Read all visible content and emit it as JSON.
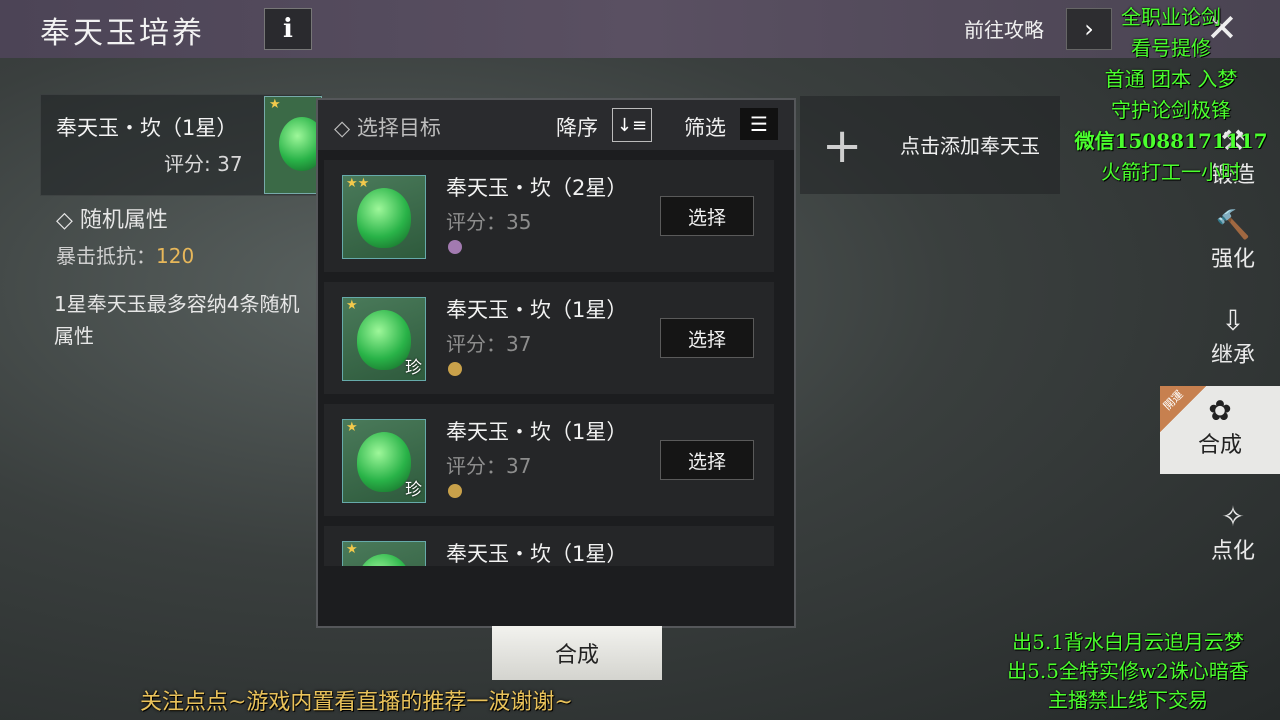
{
  "header": {
    "title": "奉天玉培养",
    "info_icon": "i",
    "guide_label": "前往攻略",
    "guide_arrow": "›",
    "close_icon": "✕"
  },
  "current_gem": {
    "name": "奉天玉・坎（1星）",
    "score": "评分: 37",
    "attr_title": "◇ 随机属性",
    "attr_name": "暴击抵抗：",
    "attr_value": "120",
    "note": "1星奉天玉最多容纳4条随机属性"
  },
  "add_slot": {
    "plus": "+",
    "text": "点击添加奉天玉"
  },
  "side_menu": [
    {
      "label": "锻造",
      "icon": "⚒"
    },
    {
      "label": "强化",
      "icon": "🔨"
    },
    {
      "label": "继承",
      "icon": "⇩"
    },
    {
      "label": "合成",
      "icon": "✿",
      "badge": "開運"
    },
    {
      "label": "点化",
      "icon": "✧"
    }
  ],
  "popup": {
    "title": "◇ 选择目标",
    "sort_label": "降序",
    "sort_icon": "↓≡",
    "filter_label": "筛选",
    "filter_icon": "☰",
    "items": [
      {
        "name": "奉天玉・坎（2星）",
        "score": "评分：35",
        "stars": "★★",
        "tag": "",
        "dot": "#a27ab0",
        "button": "选择"
      },
      {
        "name": "奉天玉・坎（1星）",
        "score": "评分：37",
        "stars": "★",
        "tag": "珍",
        "dot": "#c9a14a",
        "button": "选择"
      },
      {
        "name": "奉天玉・坎（1星）",
        "score": "评分：37",
        "stars": "★",
        "tag": "珍",
        "dot": "#c9a14a",
        "button": "选择"
      },
      {
        "name": "奉天玉・坎（1星）",
        "score": "",
        "stars": "★",
        "tag": "",
        "dot": "",
        "button": ""
      }
    ]
  },
  "combine_button": "合成",
  "overlay": {
    "top_right": [
      "全职业论剑",
      "看号提修",
      "首通 团本 入梦",
      "守护论剑极锋",
      "微信15088171117",
      "火箭打工一小时"
    ],
    "bottom_right": [
      "出5.1背水白月云追月云梦",
      "出5.5全特实修w2诛心暗香",
      "主播禁止线下交易"
    ],
    "bottom": "关注点点~游戏内置看直播的推荐一波谢谢~"
  }
}
